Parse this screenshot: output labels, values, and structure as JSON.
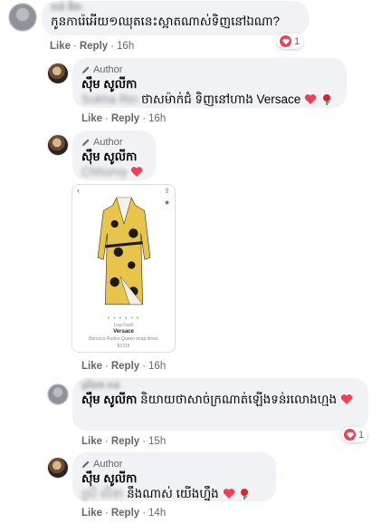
{
  "colors": {
    "heart": "#f33e58",
    "rose": "#d8242f",
    "meta": "#65676b",
    "bubble": "#f0f2f5"
  },
  "comments": [
    {
      "name": "ចាន់ នីតា",
      "text": "កូនការ៉េអើយ១ឈុតនេះស្អាតណាស់ទិញនៅឯណា?",
      "actions": {
        "like": "Like",
        "reply": "Reply",
        "time": "16h"
      },
      "reactions": {
        "count": "1"
      }
    },
    {
      "author_badge": "Author",
      "name": "ស៊ឹម សូលីកា",
      "hidden_name": "Sokha Rin",
      "text": "ថាសម៉ាក់ជំ ទិញនៅហាង Versace",
      "actions": {
        "like": "Like",
        "reply": "Reply",
        "time": "16h"
      }
    },
    {
      "author_badge": "Author",
      "name": "ស៊ឹម សូលីកា",
      "hidden_name": "Chhorvy",
      "actions": {
        "like": "Like",
        "reply": "Reply",
        "time": "16h"
      }
    },
    {
      "name": "ស្រីនាង ចាន់",
      "text_name": "ស៊ឹម សូលីកា",
      "text": "និយាយថាសាច់ក្រណាត់ឡើងទន់រលោងហ្មង",
      "actions": {
        "like": "Like",
        "reply": "Reply",
        "time": "15h"
      },
      "reactions": {
        "count": "1"
      }
    },
    {
      "author_badge": "Author",
      "name": "ស៊ឹម សូលីកា",
      "hidden_name": "ស្រី លីនា",
      "text": "នឹងណាស់ យើងហ្នឹង",
      "actions": {
        "like": "Like",
        "reply": "Reply",
        "time": "14h"
      }
    }
  ],
  "product": {
    "source": "Low Fash",
    "brand": "Versace",
    "title": "Barocco Rodeo Queen wrap dress",
    "price": "$1315"
  }
}
